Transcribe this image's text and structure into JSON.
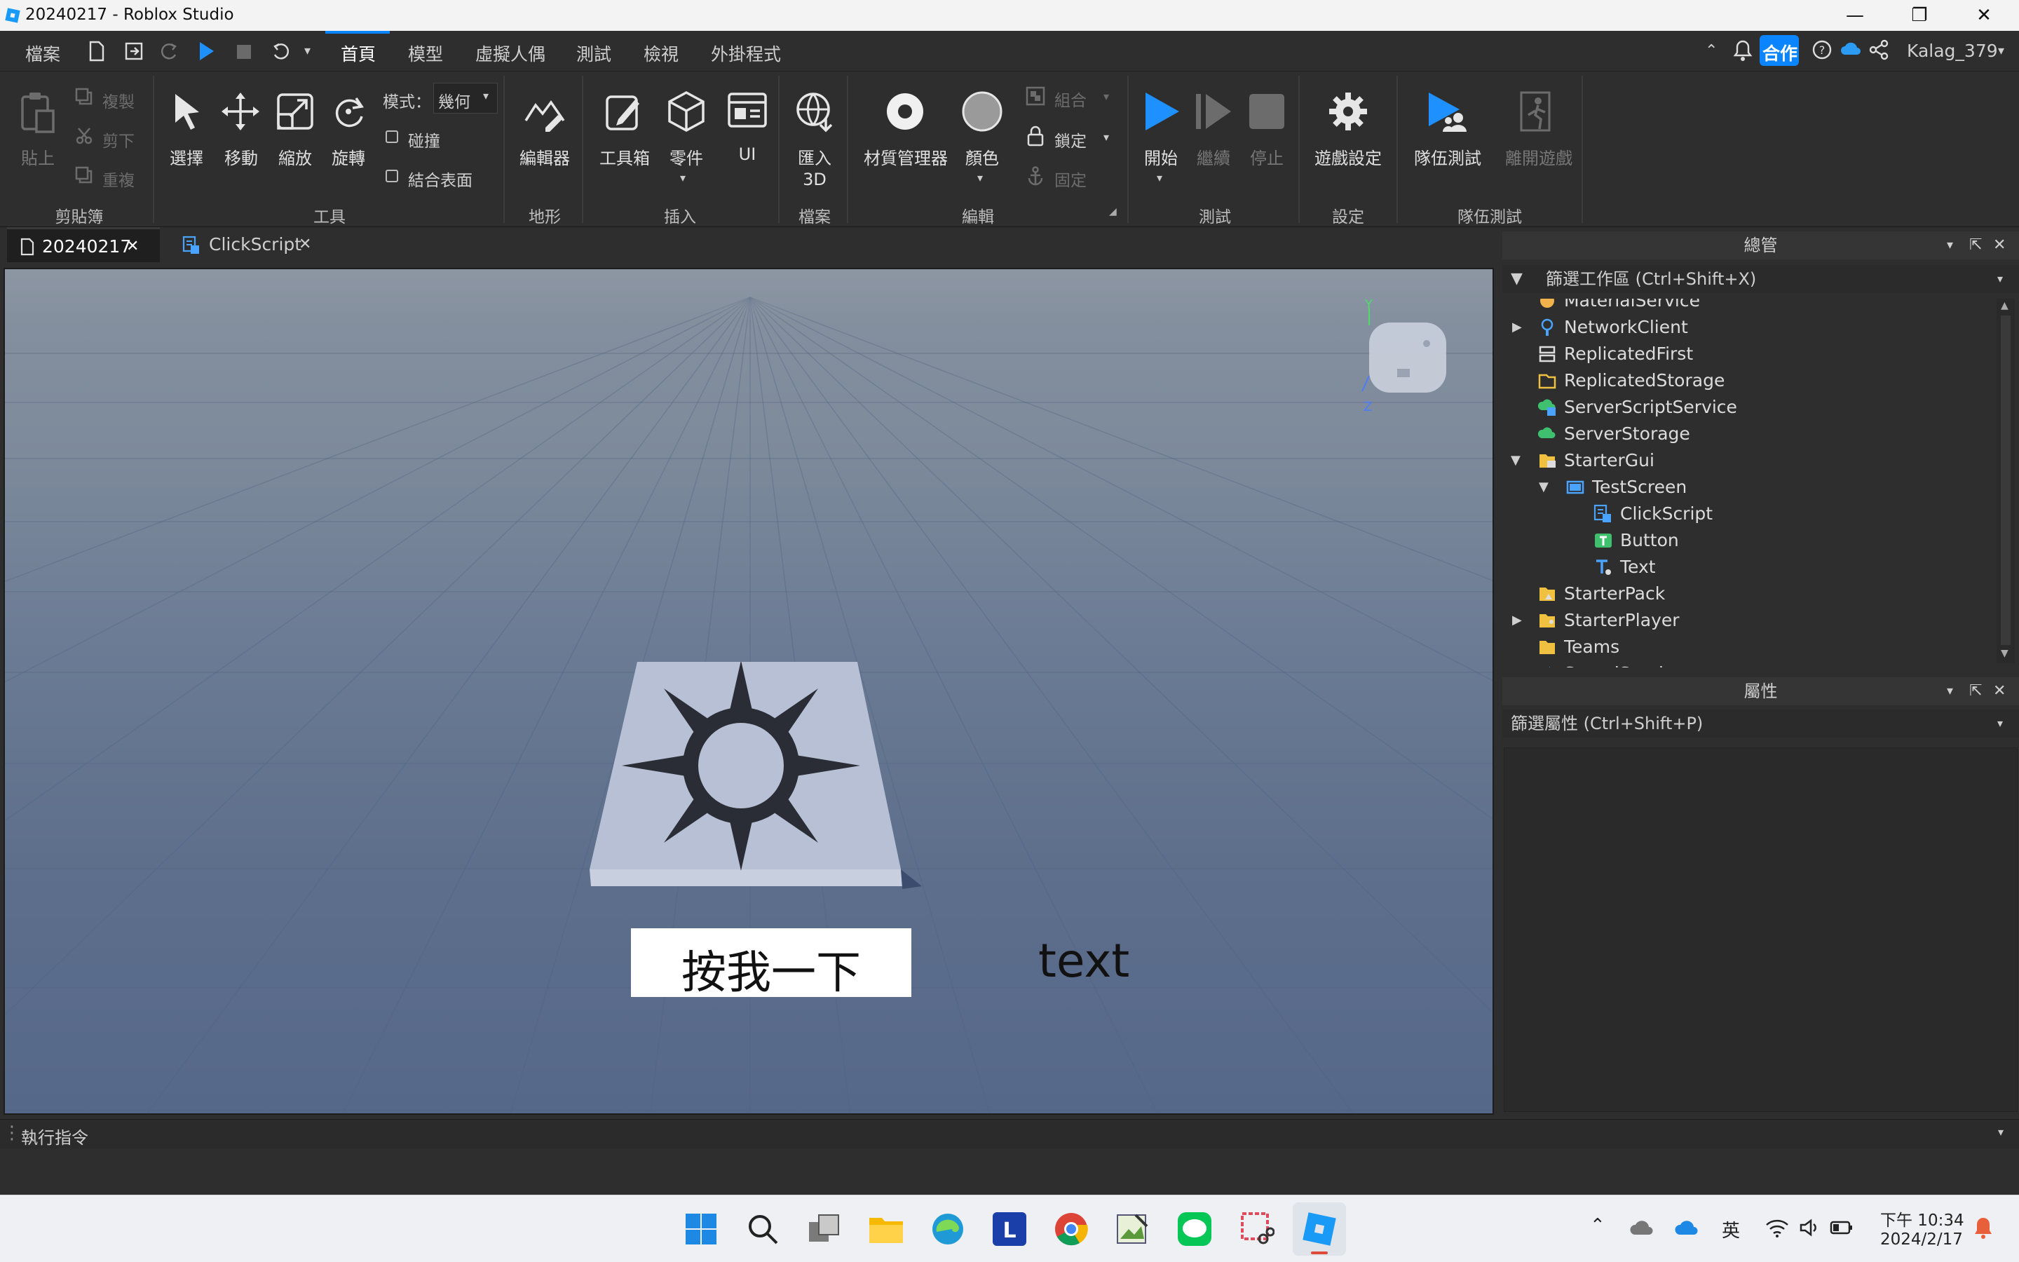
{
  "window": {
    "title": "20240217 - Roblox Studio",
    "controls": {
      "minimize": "—",
      "maximize": "❐",
      "close": "✕"
    }
  },
  "menubar": {
    "file": "檔案",
    "tabs": [
      "首頁",
      "模型",
      "虛擬人偶",
      "測試",
      "檢視",
      "外掛程式"
    ],
    "collab": "合作",
    "user": "Kalag_379"
  },
  "ribbon": {
    "clipboard": {
      "paste": "貼上",
      "copy": "複製",
      "cut": "剪下",
      "duplicate": "重複",
      "group": "剪貼簿"
    },
    "tools": {
      "select": "選擇",
      "move": "移動",
      "scale": "縮放",
      "rotate": "旋轉",
      "mode_label": "模式：",
      "mode_value": "幾何",
      "collide": "碰撞",
      "join": "結合表面",
      "group": "工具"
    },
    "terrain": {
      "editor": "編輯器",
      "group": "地形"
    },
    "insert": {
      "toolbox": "工具箱",
      "part": "零件",
      "ui": "UI",
      "group": "插入"
    },
    "file": {
      "import3d_line1": "匯入",
      "import3d_line2": "3D",
      "group": "檔案"
    },
    "edit": {
      "material": "材質管理器",
      "color": "顏色",
      "group_label": "組合",
      "lock": "鎖定",
      "anchor": "固定",
      "group": "編輯"
    },
    "test": {
      "play": "開始",
      "resume": "繼續",
      "stop": "停止",
      "group": "測試"
    },
    "settings": {
      "game_settings": "遊戲設定",
      "group": "設定"
    },
    "team_test": {
      "team_test": "隊伍測試",
      "exit_game": "離開遊戲",
      "group": "隊伍測試"
    }
  },
  "doc_tabs": [
    {
      "label": "20240217"
    },
    {
      "label": "ClickScript"
    }
  ],
  "viewport": {
    "button_text": "按我一下",
    "text_label": "text",
    "axis_y": "Y",
    "axis_z": "Z"
  },
  "explorer": {
    "title": "總管",
    "filter": "篩選工作區 (Ctrl+Shift+X)",
    "items": [
      {
        "label": "MaterialService"
      },
      {
        "label": "NetworkClient"
      },
      {
        "label": "ReplicatedFirst"
      },
      {
        "label": "ReplicatedStorage"
      },
      {
        "label": "ServerScriptService"
      },
      {
        "label": "ServerStorage"
      },
      {
        "label": "StarterGui"
      },
      {
        "label": "TestScreen"
      },
      {
        "label": "ClickScript"
      },
      {
        "label": "Button"
      },
      {
        "label": "Text"
      },
      {
        "label": "StarterPack"
      },
      {
        "label": "StarterPlayer"
      },
      {
        "label": "Teams"
      },
      {
        "label": "SoundService"
      }
    ]
  },
  "properties": {
    "title": "屬性",
    "filter": "篩選屬性 (Ctrl+Shift+P)"
  },
  "command_bar": {
    "placeholder": "執行指令"
  },
  "taskbar": {
    "ime": "英",
    "time": "下午 10:34",
    "date": "2024/2/17"
  },
  "colors": {
    "accent": "#0a84ff",
    "play": "#1e90ff",
    "collab": "#0a84ff"
  }
}
